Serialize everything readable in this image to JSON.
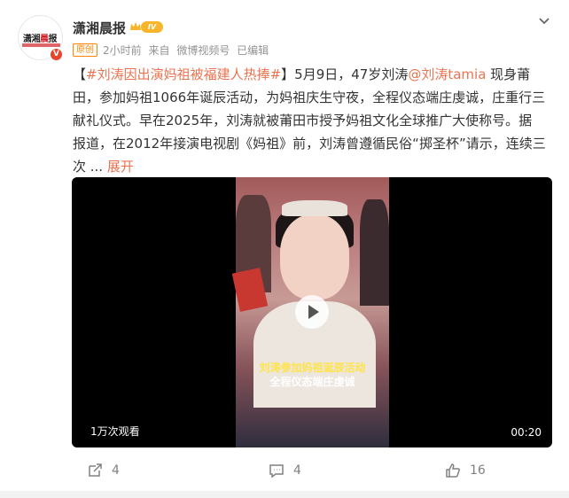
{
  "account": {
    "name": "潇湘晨报",
    "level": "IV",
    "avatar_text_black": "潇湘",
    "avatar_text_red": "晨",
    "avatar_text_black2": "报",
    "verified": "V"
  },
  "meta": {
    "original_tag": "原创",
    "time": "2小时前",
    "source_prefix": "来自",
    "source": "微博视频号",
    "edited": "已编辑"
  },
  "post": {
    "topic": "#刘涛因出演妈祖被福建人热捧#",
    "line1_a": "【",
    "line1_b": "】5月9日，47岁刘涛",
    "mention": "@刘涛tamia",
    "line1_c": " 现身莆",
    "line2": "田，参加妈祖1066年诞辰活动，为妈祖庆生守夜，全程仪态端庄虔诚，庄重行三",
    "line3": "献礼仪式。早在2025年，刘涛就被莆田市授予妈祖文化全球推广大使称号。据",
    "line4": "报道，在2012年接演电视剧《妈祖》前，刘涛曾遵循民俗“掷圣杯”请示，连续三",
    "line5": "次  ... ",
    "expand": "展开"
  },
  "video": {
    "caption_line1": "刘涛参加妈祖诞辰活动",
    "caption_line2": "全程仪态端庄虔诚",
    "views": "1万次观看",
    "duration": "00:20"
  },
  "actions": {
    "repost_count": "4",
    "comment_count": "4",
    "like_count": "16"
  },
  "colors": {
    "link": "#eb7350",
    "original_tag": "#ff8200",
    "verified_badge": "#e8452c"
  }
}
